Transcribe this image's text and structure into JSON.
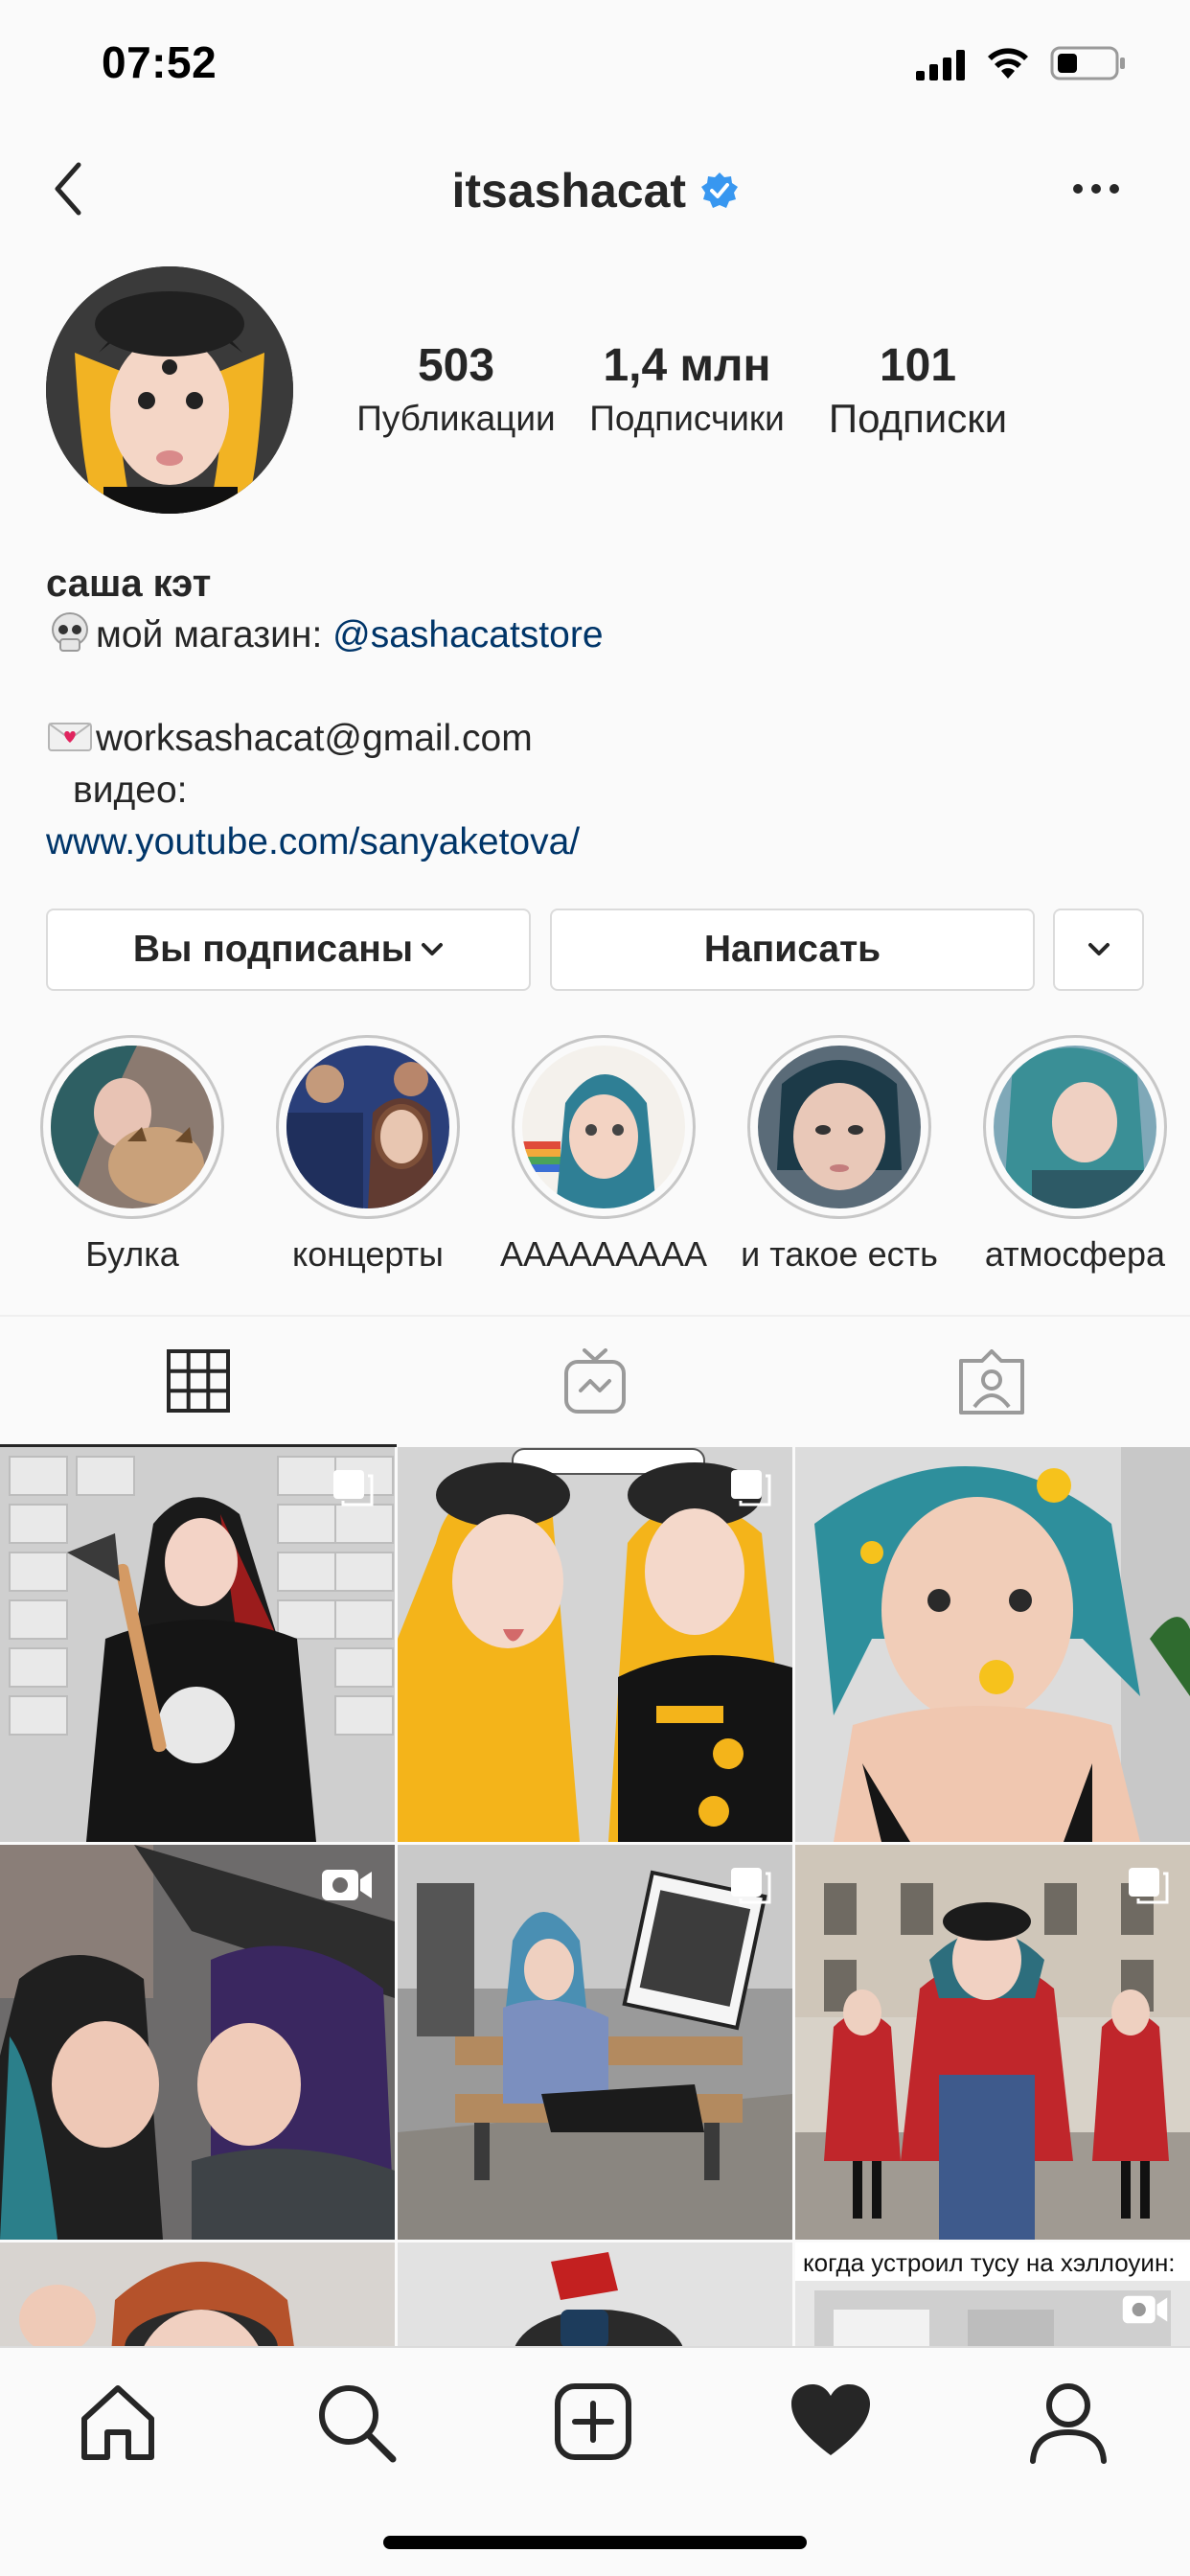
{
  "status_bar": {
    "time": "07:52"
  },
  "header": {
    "username": "itsashacat"
  },
  "profile": {
    "stats": {
      "posts": {
        "value": "503",
        "label": "Публикации"
      },
      "followers": {
        "value": "1,4 млн",
        "label": "Подписчики"
      },
      "following": {
        "value": "101",
        "label": "Подписки"
      }
    },
    "bio": {
      "name": "саша кэт",
      "store_prefix": "мой магазин: ",
      "store_handle": "@sashacatstore",
      "email": "worksashacat@gmail.com",
      "video_label": "видео:",
      "youtube": "www.youtube.com/sanyaketova/"
    }
  },
  "actions": {
    "follow_label": "Вы подписаны",
    "message_label": "Написать"
  },
  "highlights": [
    {
      "label": "Булка"
    },
    {
      "label": "концерты"
    },
    {
      "label": "ААААААААА"
    },
    {
      "label": "и такое есть"
    },
    {
      "label": "атмосфера"
    }
  ],
  "posts": {
    "caption_text": "когда устроил тусу на хэллоуин:"
  },
  "colors": {
    "link": "#003569",
    "verified": "#3897f0",
    "border": "#dbdbdb"
  }
}
